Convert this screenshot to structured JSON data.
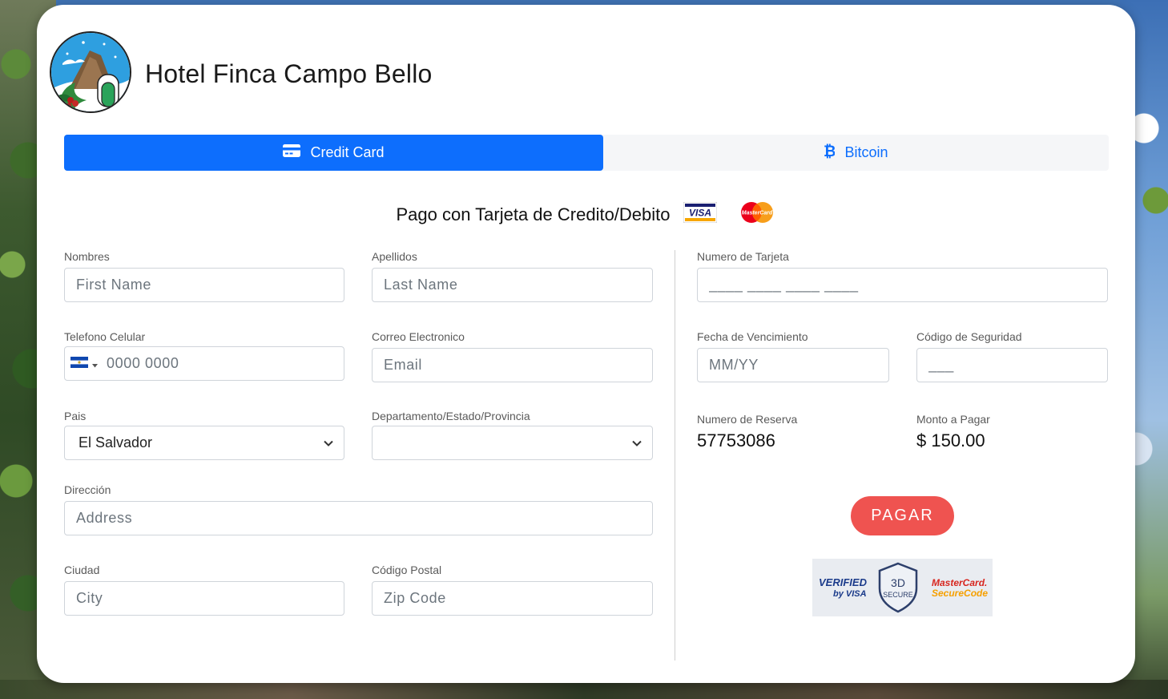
{
  "hotel": {
    "name": "Hotel Finca Campo Bello"
  },
  "tabs": [
    {
      "label": "Credit Card",
      "icon": "credit-card-icon",
      "active": true
    },
    {
      "label": "Bitcoin",
      "icon": "bitcoin-icon",
      "active": false
    }
  ],
  "payment": {
    "title": "Pago con Tarjeta de Credito/Debito",
    "brands": {
      "visa": "VISA",
      "mastercard": "MasterCard"
    }
  },
  "form": {
    "nombres": {
      "label": "Nombres",
      "placeholder": "First Name"
    },
    "apellidos": {
      "label": "Apellidos",
      "placeholder": "Last Name"
    },
    "telefono": {
      "label": "Telefono Celular",
      "placeholder": "0000 0000"
    },
    "correo": {
      "label": "Correo Electronico",
      "placeholder": "Email"
    },
    "pais": {
      "label": "Pais",
      "value": "El Salvador"
    },
    "departamento": {
      "label": "Departamento/Estado/Provincia",
      "value": ""
    },
    "direccion": {
      "label": "Dirección",
      "placeholder": "Address"
    },
    "ciudad": {
      "label": "Ciudad",
      "placeholder": "City"
    },
    "postal": {
      "label": "Código Postal",
      "placeholder": "Zip Code"
    }
  },
  "card": {
    "numero": {
      "label": "Numero de Tarjeta",
      "placeholder": "____ ____ ____ ____"
    },
    "vencimiento": {
      "label": "Fecha de Vencimiento",
      "placeholder": "MM/YY"
    },
    "codigo": {
      "label": "Código de Seguridad",
      "placeholder": "___"
    }
  },
  "reserva": {
    "label": "Numero de Reserva",
    "value": "57753086"
  },
  "monto": {
    "label": "Monto a Pagar",
    "value": "$ 150.00"
  },
  "pay_button": "PAGAR",
  "secure": {
    "verified_line1": "VERIFIED",
    "verified_line2": "by VISA",
    "threed_line1": "3D",
    "threed_line2": "SECURE",
    "mc_line1": "MasterCard.",
    "mc_line2": "SecureCode."
  },
  "colors": {
    "primary": "#0d6efd",
    "pay": "#ef5350",
    "tab_bg": "#f5f6f8"
  }
}
